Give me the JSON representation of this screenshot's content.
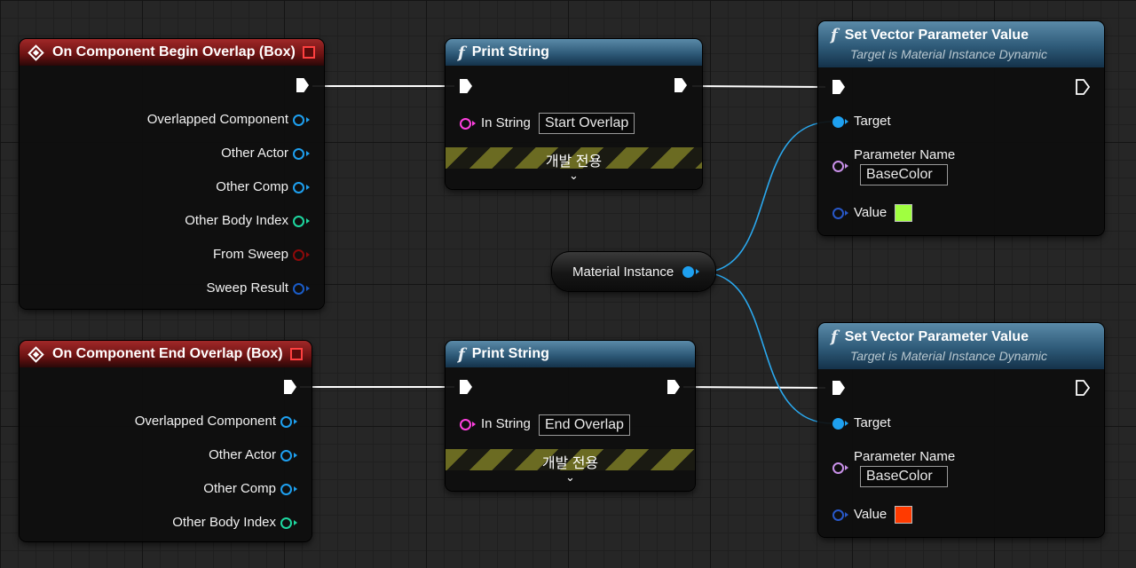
{
  "colors": {
    "exec_pin": "#ffffff",
    "object_pin": "#1ea0f0",
    "integer_pin": "#1ed8a0",
    "bool_pin": "#8c0a0a",
    "struct_pin": "#1a5cc8",
    "name_pin": "#c890e8",
    "string_pin": "#ff40e0",
    "vector_pin": "#2858c8",
    "swatch_green": "#a0ff40",
    "swatch_red": "#ff3a00"
  },
  "begin_overlap": {
    "title": "On Component Begin Overlap (Box)",
    "icon": "event-diamond-icon",
    "pins": [
      "Overlapped Component",
      "Other Actor",
      "Other Comp",
      "Other Body Index",
      "From Sweep",
      "Sweep Result"
    ]
  },
  "end_overlap": {
    "title": "On Component End Overlap (Box)",
    "icon": "event-diamond-icon",
    "pins": [
      "Overlapped Component",
      "Other Actor",
      "Other Comp",
      "Other Body Index"
    ]
  },
  "print_top": {
    "title": "Print String",
    "in_string_label": "In String",
    "in_string_value": "Start Overlap",
    "dev_only": "개발 전용"
  },
  "print_bottom": {
    "title": "Print String",
    "in_string_label": "In String",
    "in_string_value": "End Overlap",
    "dev_only": "개발 전용"
  },
  "material_instance": {
    "label": "Material Instance"
  },
  "set_vec_top": {
    "title": "Set Vector Parameter Value",
    "subtitle": "Target is Material Instance Dynamic",
    "target_label": "Target",
    "param_label": "Parameter Name",
    "param_value": "BaseColor",
    "value_label": "Value"
  },
  "set_vec_bottom": {
    "title": "Set Vector Parameter Value",
    "subtitle": "Target is Material Instance Dynamic",
    "target_label": "Target",
    "param_label": "Parameter Name",
    "param_value": "BaseColor",
    "value_label": "Value"
  }
}
